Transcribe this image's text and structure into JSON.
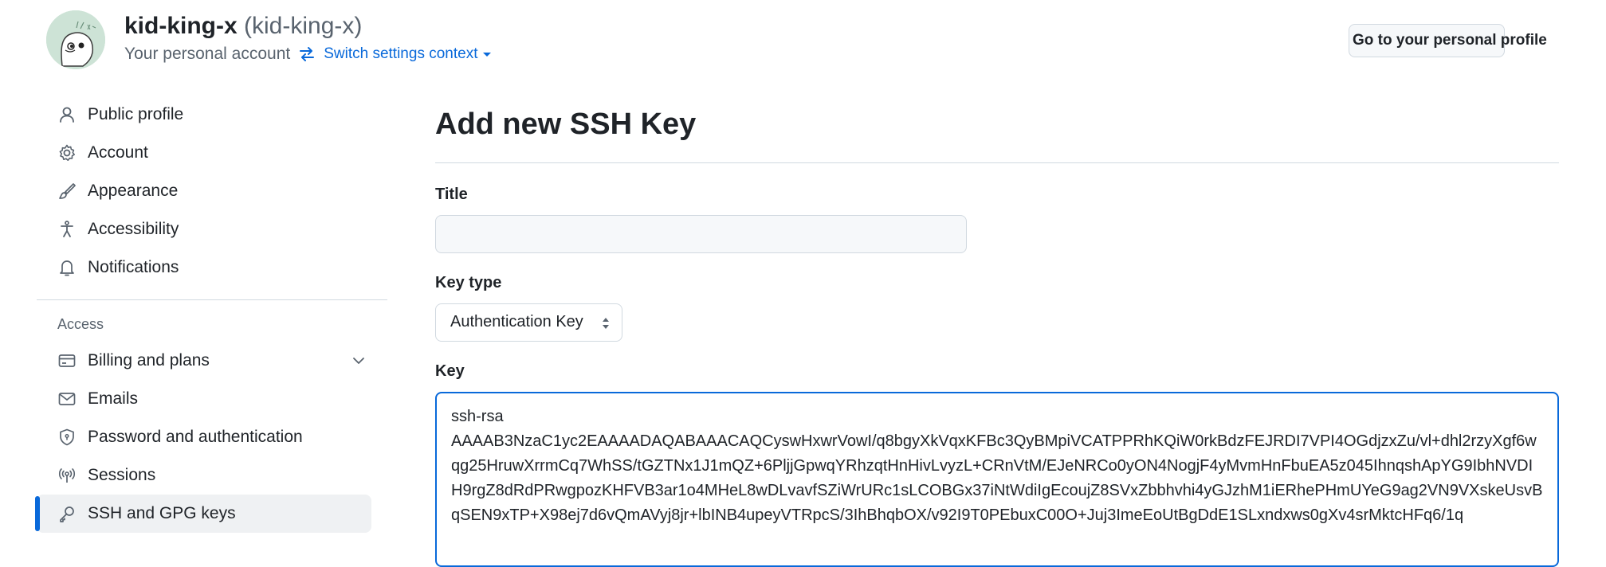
{
  "header": {
    "login": "kid-king-x",
    "handle": "(kid-king-x)",
    "subtitle": "Your personal account",
    "switch_label": "Switch settings context",
    "profile_button": "Go to your personal profile"
  },
  "sidebar": {
    "items": [
      {
        "label": "Public profile",
        "icon": "person-icon"
      },
      {
        "label": "Account",
        "icon": "gear-icon"
      },
      {
        "label": "Appearance",
        "icon": "paintbrush-icon"
      },
      {
        "label": "Accessibility",
        "icon": "accessibility-icon"
      },
      {
        "label": "Notifications",
        "icon": "bell-icon"
      }
    ],
    "access_title": "Access",
    "access_items": [
      {
        "label": "Billing and plans",
        "icon": "credit-card-icon"
      },
      {
        "label": "Emails",
        "icon": "mail-icon"
      },
      {
        "label": "Password and authentication",
        "icon": "shield-lock-icon"
      },
      {
        "label": "Sessions",
        "icon": "broadcast-icon"
      },
      {
        "label": "SSH and GPG keys",
        "icon": "key-icon"
      }
    ]
  },
  "main": {
    "title": "Add new SSH Key",
    "title_label": "Title",
    "title_value": "",
    "key_type_label": "Key type",
    "key_type_value": "Authentication Key",
    "key_label": "Key",
    "key_value": "ssh-rsa\nAAAAB3NzaC1yc2EAAAADAQABAAACAQCyswHxwrVowI/q8bgyXkVqxKFBc3QyBMpiVCATPPRhKQiW0rkBdzFEJRDI7VPI4OGdjzxZu/vl+dhl2rzyXgf6wqg25HruwXrrmCq7WhSS/tGZTNx1J1mQZ+6PljjGpwqYRhzqtHnHivLvyzL+CRnVtM/EJeNRCo0yON4NogjF4yMvmHnFbuEA5z045IhnqshApYG9IbhNVDIH9rgZ8dRdPRwgpozKHFVB3ar1o4MHeL8wDLvavfSZiWrURc1sLCOBGx37iNtWdiIgEcoujZ8SVxZbbhvhi4yGJzhM1iERhePHmUYeG9ag2VN9VXskeUsvBqSEN9xTP+X98ej7d6vQmAVyj8jr+lbINB4upeyVTRpcS/3IhBhqbOX/v92I9T0PEbuxC00O+Juj3ImeEoUtBgDdE1SLxndxws0gXv4srMktcHFq6/1q"
  }
}
